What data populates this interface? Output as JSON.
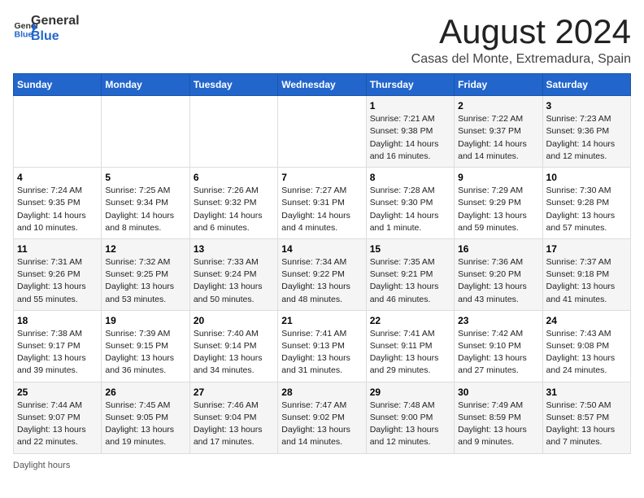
{
  "header": {
    "logo_line1": "General",
    "logo_line2": "Blue",
    "title": "August 2024",
    "subtitle": "Casas del Monte, Extremadura, Spain"
  },
  "weekdays": [
    "Sunday",
    "Monday",
    "Tuesday",
    "Wednesday",
    "Thursday",
    "Friday",
    "Saturday"
  ],
  "weeks": [
    [
      {
        "day": "",
        "info": ""
      },
      {
        "day": "",
        "info": ""
      },
      {
        "day": "",
        "info": ""
      },
      {
        "day": "",
        "info": ""
      },
      {
        "day": "1",
        "info": "Sunrise: 7:21 AM\nSunset: 9:38 PM\nDaylight: 14 hours\nand 16 minutes."
      },
      {
        "day": "2",
        "info": "Sunrise: 7:22 AM\nSunset: 9:37 PM\nDaylight: 14 hours\nand 14 minutes."
      },
      {
        "day": "3",
        "info": "Sunrise: 7:23 AM\nSunset: 9:36 PM\nDaylight: 14 hours\nand 12 minutes."
      }
    ],
    [
      {
        "day": "4",
        "info": "Sunrise: 7:24 AM\nSunset: 9:35 PM\nDaylight: 14 hours\nand 10 minutes."
      },
      {
        "day": "5",
        "info": "Sunrise: 7:25 AM\nSunset: 9:34 PM\nDaylight: 14 hours\nand 8 minutes."
      },
      {
        "day": "6",
        "info": "Sunrise: 7:26 AM\nSunset: 9:32 PM\nDaylight: 14 hours\nand 6 minutes."
      },
      {
        "day": "7",
        "info": "Sunrise: 7:27 AM\nSunset: 9:31 PM\nDaylight: 14 hours\nand 4 minutes."
      },
      {
        "day": "8",
        "info": "Sunrise: 7:28 AM\nSunset: 9:30 PM\nDaylight: 14 hours\nand 1 minute."
      },
      {
        "day": "9",
        "info": "Sunrise: 7:29 AM\nSunset: 9:29 PM\nDaylight: 13 hours\nand 59 minutes."
      },
      {
        "day": "10",
        "info": "Sunrise: 7:30 AM\nSunset: 9:28 PM\nDaylight: 13 hours\nand 57 minutes."
      }
    ],
    [
      {
        "day": "11",
        "info": "Sunrise: 7:31 AM\nSunset: 9:26 PM\nDaylight: 13 hours\nand 55 minutes."
      },
      {
        "day": "12",
        "info": "Sunrise: 7:32 AM\nSunset: 9:25 PM\nDaylight: 13 hours\nand 53 minutes."
      },
      {
        "day": "13",
        "info": "Sunrise: 7:33 AM\nSunset: 9:24 PM\nDaylight: 13 hours\nand 50 minutes."
      },
      {
        "day": "14",
        "info": "Sunrise: 7:34 AM\nSunset: 9:22 PM\nDaylight: 13 hours\nand 48 minutes."
      },
      {
        "day": "15",
        "info": "Sunrise: 7:35 AM\nSunset: 9:21 PM\nDaylight: 13 hours\nand 46 minutes."
      },
      {
        "day": "16",
        "info": "Sunrise: 7:36 AM\nSunset: 9:20 PM\nDaylight: 13 hours\nand 43 minutes."
      },
      {
        "day": "17",
        "info": "Sunrise: 7:37 AM\nSunset: 9:18 PM\nDaylight: 13 hours\nand 41 minutes."
      }
    ],
    [
      {
        "day": "18",
        "info": "Sunrise: 7:38 AM\nSunset: 9:17 PM\nDaylight: 13 hours\nand 39 minutes."
      },
      {
        "day": "19",
        "info": "Sunrise: 7:39 AM\nSunset: 9:15 PM\nDaylight: 13 hours\nand 36 minutes."
      },
      {
        "day": "20",
        "info": "Sunrise: 7:40 AM\nSunset: 9:14 PM\nDaylight: 13 hours\nand 34 minutes."
      },
      {
        "day": "21",
        "info": "Sunrise: 7:41 AM\nSunset: 9:13 PM\nDaylight: 13 hours\nand 31 minutes."
      },
      {
        "day": "22",
        "info": "Sunrise: 7:41 AM\nSunset: 9:11 PM\nDaylight: 13 hours\nand 29 minutes."
      },
      {
        "day": "23",
        "info": "Sunrise: 7:42 AM\nSunset: 9:10 PM\nDaylight: 13 hours\nand 27 minutes."
      },
      {
        "day": "24",
        "info": "Sunrise: 7:43 AM\nSunset: 9:08 PM\nDaylight: 13 hours\nand 24 minutes."
      }
    ],
    [
      {
        "day": "25",
        "info": "Sunrise: 7:44 AM\nSunset: 9:07 PM\nDaylight: 13 hours\nand 22 minutes."
      },
      {
        "day": "26",
        "info": "Sunrise: 7:45 AM\nSunset: 9:05 PM\nDaylight: 13 hours\nand 19 minutes."
      },
      {
        "day": "27",
        "info": "Sunrise: 7:46 AM\nSunset: 9:04 PM\nDaylight: 13 hours\nand 17 minutes."
      },
      {
        "day": "28",
        "info": "Sunrise: 7:47 AM\nSunset: 9:02 PM\nDaylight: 13 hours\nand 14 minutes."
      },
      {
        "day": "29",
        "info": "Sunrise: 7:48 AM\nSunset: 9:00 PM\nDaylight: 13 hours\nand 12 minutes."
      },
      {
        "day": "30",
        "info": "Sunrise: 7:49 AM\nSunset: 8:59 PM\nDaylight: 13 hours\nand 9 minutes."
      },
      {
        "day": "31",
        "info": "Sunrise: 7:50 AM\nSunset: 8:57 PM\nDaylight: 13 hours\nand 7 minutes."
      }
    ]
  ],
  "footer": {
    "daylight_label": "Daylight hours"
  }
}
